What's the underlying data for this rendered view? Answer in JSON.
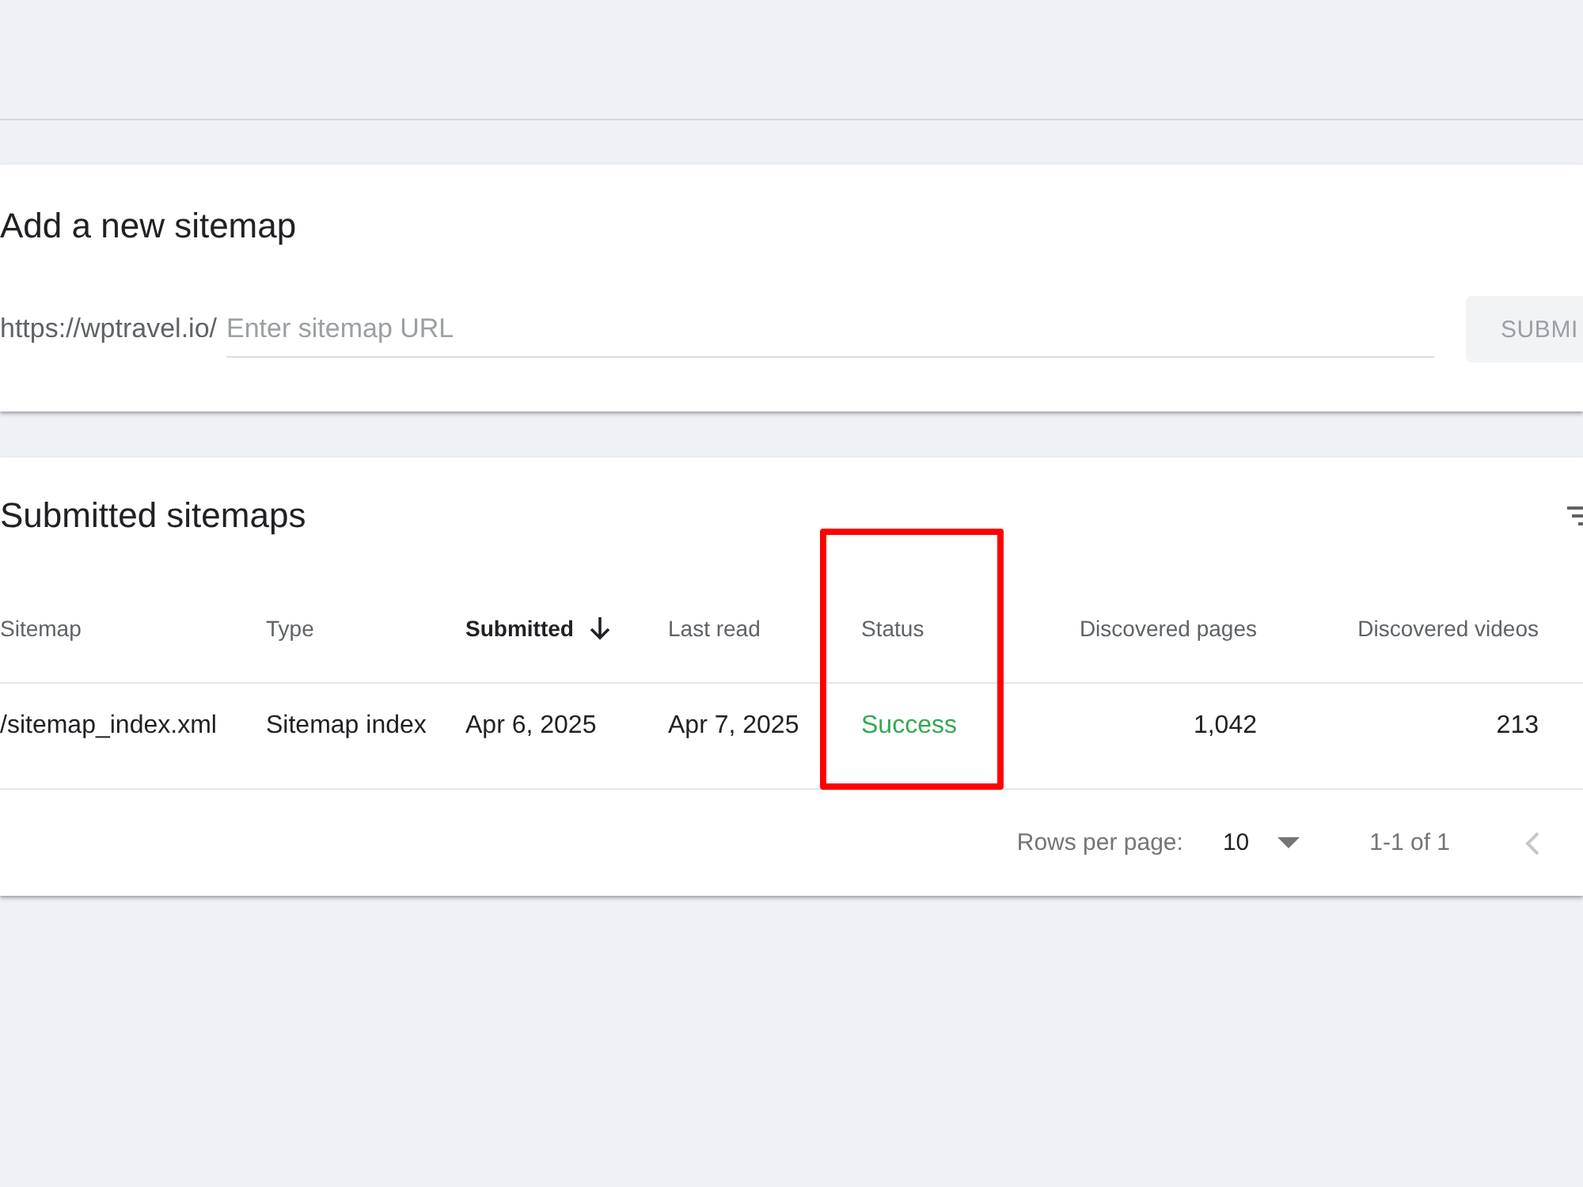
{
  "add_sitemap": {
    "title": "Add a new sitemap",
    "url_prefix": "https://wptravel.io/",
    "url_field": {
      "placeholder": "Enter sitemap URL"
    },
    "submit_button": {
      "label": "SUBMI",
      "disabled": true
    }
  },
  "submitted_sitemaps": {
    "title": "Submitted sitemaps",
    "table": {
      "columns": [
        {
          "label": "Sitemap",
          "kind": "text",
          "sorted": false,
          "highlighted": false
        },
        {
          "label": "Type",
          "kind": "text",
          "sorted": false,
          "highlighted": false
        },
        {
          "label": "Submitted",
          "kind": "text",
          "sorted": true,
          "highlighted": false
        },
        {
          "label": "Last read",
          "kind": "text",
          "sorted": false,
          "highlighted": false
        },
        {
          "label": "Status",
          "kind": "text",
          "sorted": false,
          "highlighted": true
        },
        {
          "label": "Discovered pages",
          "kind": "number",
          "sorted": false,
          "highlighted": false
        },
        {
          "label": "Discovered videos",
          "kind": "number",
          "sorted": false,
          "highlighted": false
        }
      ],
      "rows": [
        {
          "cells": [
            {
              "text": "/sitemap_index.xml",
              "kind": "plain"
            },
            {
              "text": "Sitemap index",
              "kind": "plain"
            },
            {
              "text": "Apr 6, 2025",
              "kind": "plain"
            },
            {
              "text": "Apr 7, 2025",
              "kind": "plain"
            },
            {
              "text": "Success",
              "kind": "success"
            },
            {
              "text": "1,042",
              "kind": "plain"
            },
            {
              "text": "213",
              "kind": "plain"
            }
          ]
        }
      ]
    },
    "pagination": {
      "rows_per_page_label": "Rows per page:",
      "rows_per_page": "10",
      "range": "1-1 of 1",
      "previous_disabled": true
    }
  }
}
